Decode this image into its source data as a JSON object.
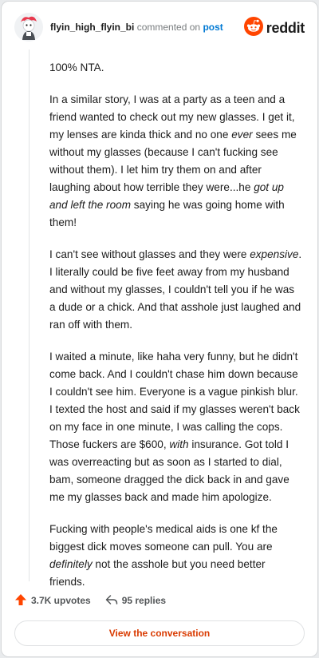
{
  "header": {
    "username": "flyin_high_flyin_bi",
    "action_text": "commented on",
    "post_link": "post",
    "brand": "reddit"
  },
  "comment": {
    "p1": "100% NTA.",
    "p2": [
      "In a similar story, I was at a party as a teen and a friend wanted to check out my new glasses. I get it, my lenses are kinda thick and no one ",
      "ever",
      " sees me without my glasses (because I can't fucking see without them). I let him try them on and after laughing about how terrible they were...he ",
      "got up and left the room",
      " saying he was going home with them!"
    ],
    "p3": [
      "I can't see without glasses and they were ",
      "expensive",
      ". I literally could be five feet away from my husband and without my glasses, I couldn't tell you if he was a dude or a chick. And that asshole just laughed and ran off with them."
    ],
    "p4": [
      "I waited a minute, like haha very funny, but he didn't come back. And I couldn't chase him down because I couldn't see him. Everyone is a vague pinkish blur. I texted the host and said if my glasses weren't back on my face in one minute, I was calling the cops. Those fuckers are $600, ",
      "with",
      " insurance. Got told I was overreacting but as soon as I started to dial, bam, someone dragged the dick back in and gave me my glasses back and made him apologize."
    ],
    "p5": [
      "Fucking with people's medical aids is one kf the biggest dick moves someone can pull. You are ",
      "definitely",
      " not the asshole but you need better friends."
    ]
  },
  "actions": {
    "upvotes": "3.7K upvotes",
    "replies": "95 replies"
  },
  "footer": {
    "button_label": "View the conversation"
  },
  "colors": {
    "upvote": "#ff4500",
    "link": "#0079d3",
    "button_text": "#d93a00"
  },
  "icons": [
    "avatar",
    "reddit-logo-icon",
    "upvote-arrow-icon",
    "reply-arrow-icon"
  ]
}
